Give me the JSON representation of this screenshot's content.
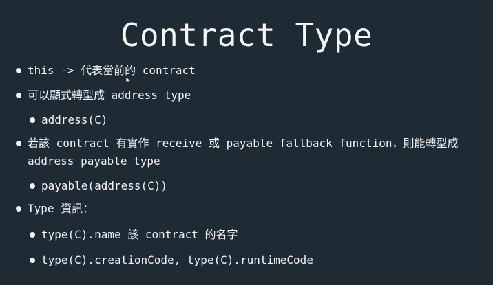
{
  "slide": {
    "title": "Contract Type",
    "items": [
      "this -> 代表當前的 contract",
      "可以顯式轉型成 address type",
      "address(C)",
      "若該 contract 有實作 receive 或 payable fallback function，則能轉型成 address payable type",
      "payable(address(C))",
      "Type 資訊：",
      "type(C).name 該 contract 的名字",
      "type(C).creationCode, type(C).runtimeCode"
    ],
    "colors": {
      "background": "#1f2b34",
      "text": "#f1f4f6"
    },
    "cursor_icon": "mouse-cursor-icon"
  }
}
